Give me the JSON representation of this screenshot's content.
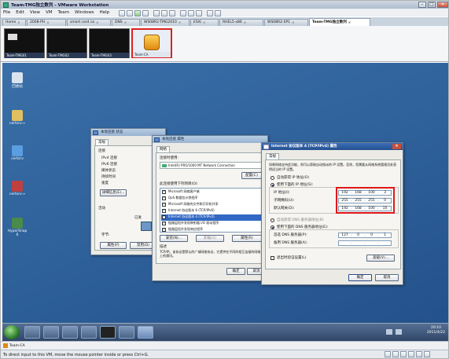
{
  "window": {
    "title": "Team-TMG独立数列 - VMware Workstation",
    "min": "–",
    "max": "□",
    "close": "×"
  },
  "menu": [
    "File",
    "Edit",
    "View",
    "VM",
    "Team",
    "Windows",
    "Help"
  ],
  "tabs": [
    {
      "label": "Home"
    },
    {
      "label": "2008-PH"
    },
    {
      "label": "smart card ca"
    },
    {
      "label": "DNS"
    },
    {
      "label": "WS08R2-TMG2010"
    },
    {
      "label": "ESXi"
    },
    {
      "label": "RHEL5-x86"
    },
    {
      "label": "WS08R2-SP1"
    },
    {
      "label": "Team-TMG独立数列",
      "active": true
    }
  ],
  "thumbnails": [
    {
      "label": "Team-TMG01"
    },
    {
      "label": "Team-TMG02"
    },
    {
      "label": "Team-TMG03"
    },
    {
      "label": "Team-CA"
    }
  ],
  "desktop_icons": [
    {
      "label": "回收站",
      "color": "#d9e4f0"
    },
    {
      "label": "certsrv-»",
      "color": "#e0c060"
    },
    {
      "label": "certsrv",
      "color": "#5a9de0"
    },
    {
      "label": "certsrv-»",
      "color": "#c04040"
    },
    {
      "label": "HyperSnap 6",
      "color": "#4a8a4a"
    }
  ],
  "status_dialog": {
    "title": "本地连接 状态",
    "tab": "常规",
    "section_connection": "连接",
    "rows": [
      "IPv4 连接",
      "IPv6 连接",
      "媒体状态",
      "持续时间",
      "速度"
    ],
    "details_button": "详细信息(E)...",
    "section_activity": "活动",
    "sent": "已发",
    "bytes": "字节:",
    "properties_button": "属性(P)",
    "disable_button": "禁用(D)"
  },
  "props_dialog": {
    "title": "本地连接 属性",
    "tab": "网络",
    "connect_using": "连接时使用:",
    "adapter": "Intel(R) PRO/1000 MT Network Connection",
    "configure_button": "配置(C)",
    "items_label": "此连接使用下列项目(O):",
    "items": [
      "Microsoft 网络客户端",
      "QoS 数据包计划程序",
      "Microsoft 网络的文件和打印机共享",
      "Internet 协议版本 6 (TCP/IPv6)",
      "Internet 协议版本 4 (TCP/IPv4)",
      "链路层拓扑发现映射器 I/O 驱动程序",
      "链路层拓扑发现响应程序"
    ],
    "install_button": "安装(N)...",
    "uninstall_button": "卸载(U)",
    "properties_button": "属性(R)",
    "description_label": "描述",
    "description": "TCP/IP。该协议是默认的广域网络协议，它提供在不同的相互连接的网络上的通讯。",
    "ok_button": "确定",
    "cancel_button": "取消"
  },
  "ipv4_dialog": {
    "title": "Internet 协议版本 4 (TCP/IPv4) 属性",
    "tab": "常规",
    "intro": "如果网络支持此功能，则可以获取自动指派的 IP 设置。否则，您需要从网络系统管理员处获得适当的 IP 设置。",
    "auto_ip": "自动获得 IP 地址(O)",
    "manual_ip": "使用下面的 IP 地址(S):",
    "ip_label": "IP 地址(I):",
    "mask_label": "子网掩码(U):",
    "gateway_label": "默认网关(D):",
    "ip": [
      "192",
      "168",
      "100",
      "3"
    ],
    "mask": [
      "255",
      "255",
      "255",
      "0"
    ],
    "gateway": [
      "192",
      "168",
      "100",
      "10"
    ],
    "auto_dns": "自动获得 DNS 服务器地址(B)",
    "manual_dns": "使用下面的 DNS 服务器地址(E):",
    "pref_dns_label": "首选 DNS 服务器(P):",
    "alt_dns_label": "备用 DNS 服务器(A):",
    "pref_dns": [
      "127",
      "0",
      "0",
      "1"
    ],
    "alt_dns": [
      "",
      "",
      "",
      ""
    ],
    "validate": "退出时验证设置(L)",
    "advanced_button": "高级(V)...",
    "ok_button": "确定",
    "cancel_button": "取消"
  },
  "tray": {
    "time": "20:10",
    "date": "2011/4/22"
  },
  "vm_status": "Team-CA",
  "bottom_hint": "To direct input to this VM, move the mouse pointer inside or press Ctrl+G."
}
